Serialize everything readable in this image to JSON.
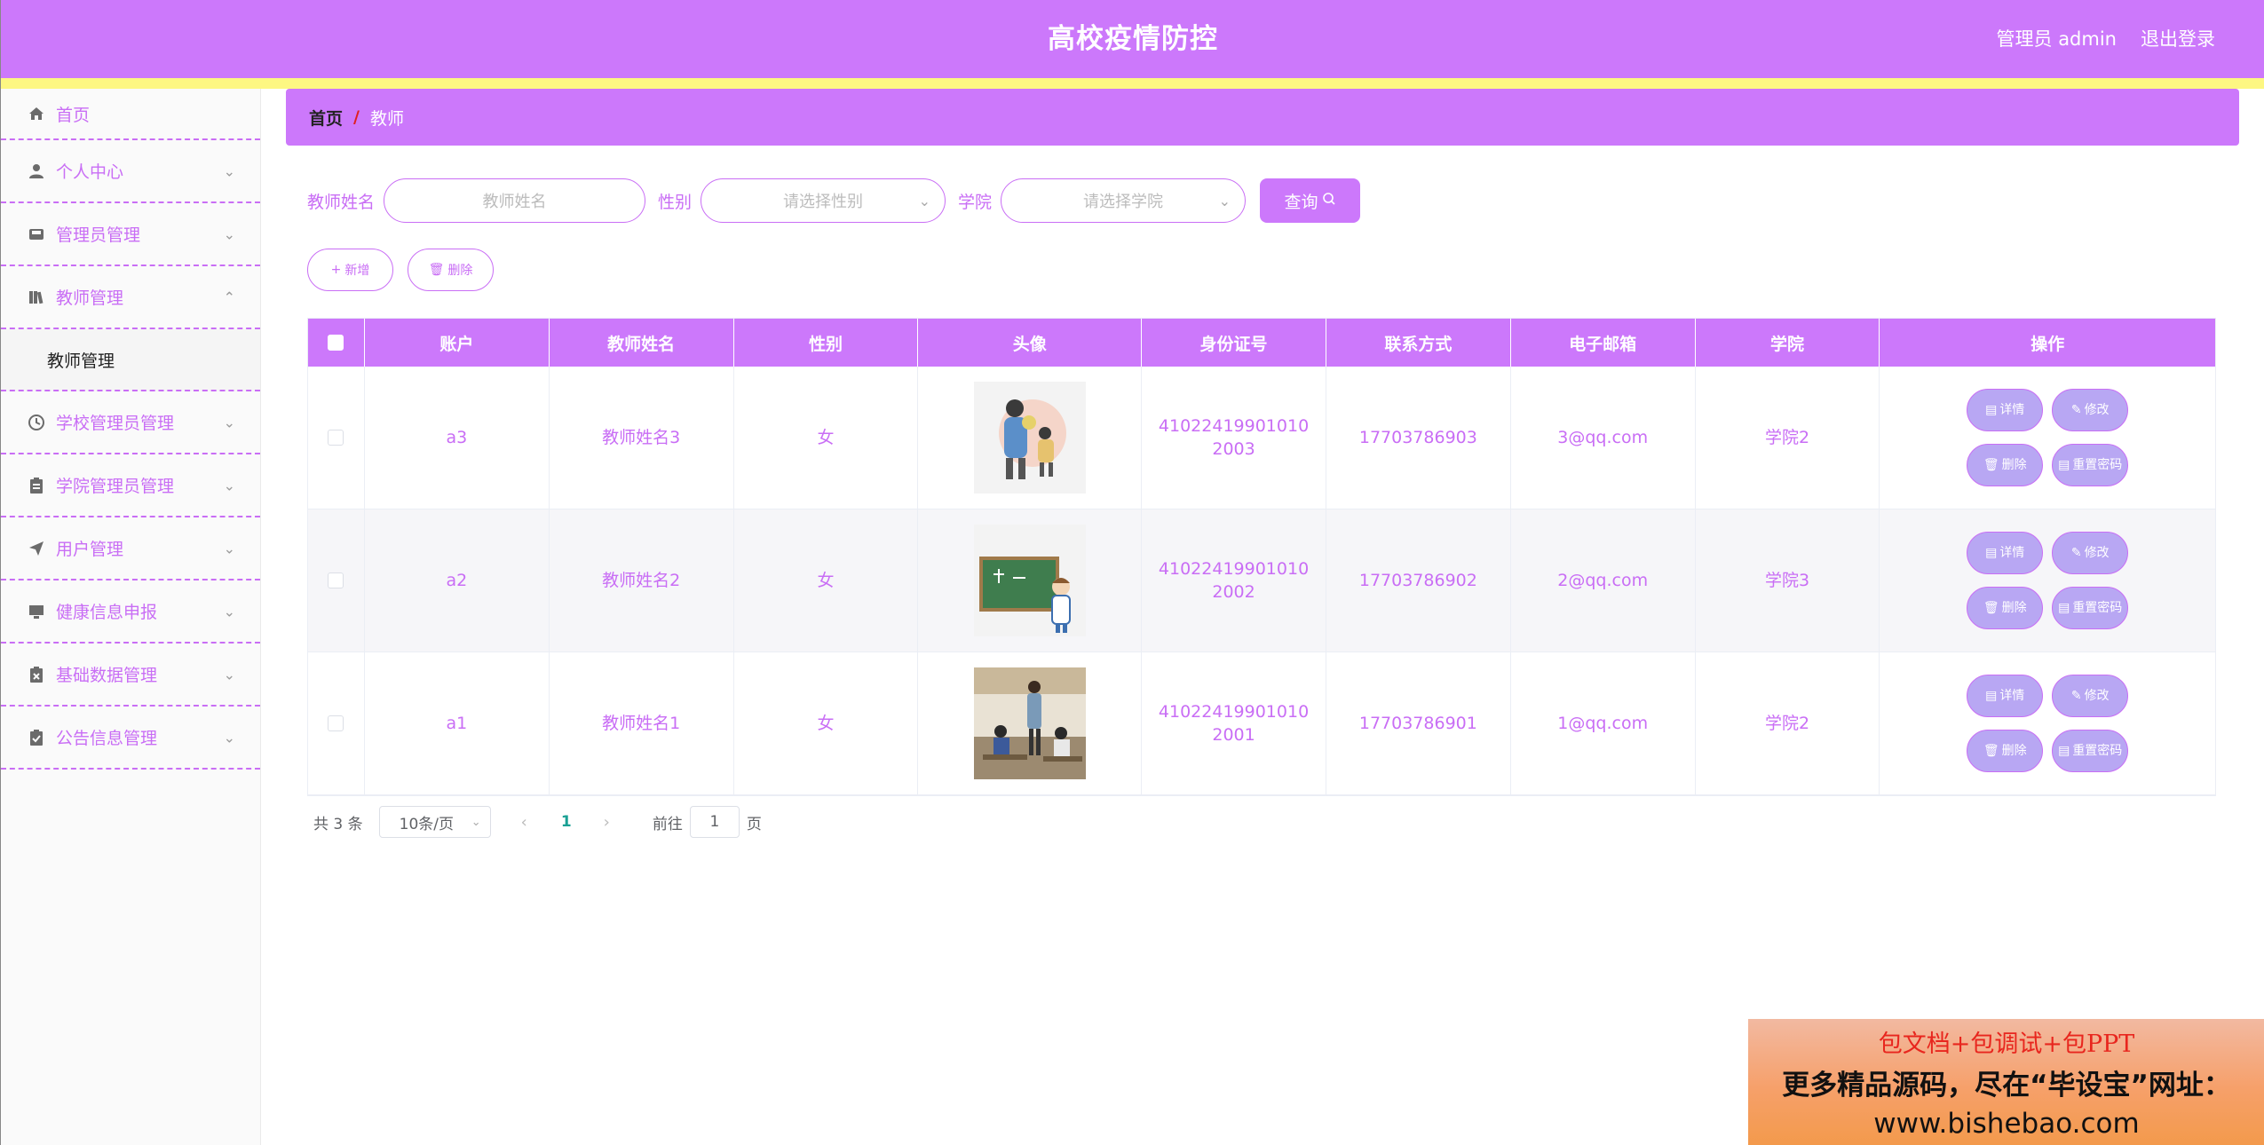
{
  "header": {
    "title": "高校疫情防控",
    "admin": "管理员 admin",
    "logout": "退出登录"
  },
  "sidebar": {
    "items": [
      {
        "label": "首页",
        "icon": "home-icon"
      },
      {
        "label": "个人中心",
        "icon": "user-icon"
      },
      {
        "label": "管理员管理",
        "icon": "inbox-icon"
      },
      {
        "label": "教师管理",
        "icon": "books-icon",
        "expanded": true
      },
      {
        "label": "学校管理员管理",
        "icon": "clock-icon"
      },
      {
        "label": "学院管理员管理",
        "icon": "clipboard-icon"
      },
      {
        "label": "用户管理",
        "icon": "paper-plane-icon"
      },
      {
        "label": "健康信息申报",
        "icon": "monitor-icon"
      },
      {
        "label": "基础数据管理",
        "icon": "clipboard-x-icon"
      },
      {
        "label": "公告信息管理",
        "icon": "clipboard-check-icon"
      }
    ],
    "submenu": {
      "label": "教师管理"
    }
  },
  "breadcrumb": {
    "home": "首页",
    "sep": "/",
    "current": "教师"
  },
  "search": {
    "name_label": "教师姓名",
    "name_placeholder": "教师姓名",
    "gender_label": "性别",
    "gender_placeholder": "请选择性别",
    "college_label": "学院",
    "college_placeholder": "请选择学院",
    "query": "查询"
  },
  "actions": {
    "add": "新增",
    "delete": "删除"
  },
  "table": {
    "columns": [
      "账户",
      "教师姓名",
      "性别",
      "头像",
      "身份证号",
      "联系方式",
      "电子邮箱",
      "学院",
      "操作"
    ],
    "rows": [
      {
        "account": "a3",
        "name": "教师姓名3",
        "gender": "女",
        "avatar": "teacher-avatar-hug",
        "id_no": "410224199010102003",
        "phone": "17703786903",
        "email": "3@qq.com",
        "college": "学院2"
      },
      {
        "account": "a2",
        "name": "教师姓名2",
        "gender": "女",
        "avatar": "teacher-avatar-blackboard",
        "id_no": "410224199010102002",
        "phone": "17703786902",
        "email": "2@qq.com",
        "college": "学院3"
      },
      {
        "account": "a1",
        "name": "教师姓名1",
        "gender": "女",
        "avatar": "teacher-avatar-classroom",
        "id_no": "410224199010102001",
        "phone": "17703786901",
        "email": "1@qq.com",
        "college": "学院2"
      }
    ],
    "ops": {
      "detail": "详情",
      "edit": "修改",
      "delete": "删除",
      "reset": "重置密码"
    }
  },
  "pager": {
    "total": "共 3 条",
    "size": "10条/页",
    "current": "1",
    "goto_prefix": "前往",
    "goto_value": "1",
    "goto_suffix": "页"
  },
  "ad": {
    "line1": "包文档+包调试+包PPT",
    "line2": "更多精品源码，尽在“毕设宝”网址：",
    "line3": "www.bishebao.com"
  },
  "colors": {
    "primary": "#cc78fb",
    "stripe": "#fdf782",
    "text_accent": "#c96ef5",
    "op_button": "#b8a7f3"
  }
}
